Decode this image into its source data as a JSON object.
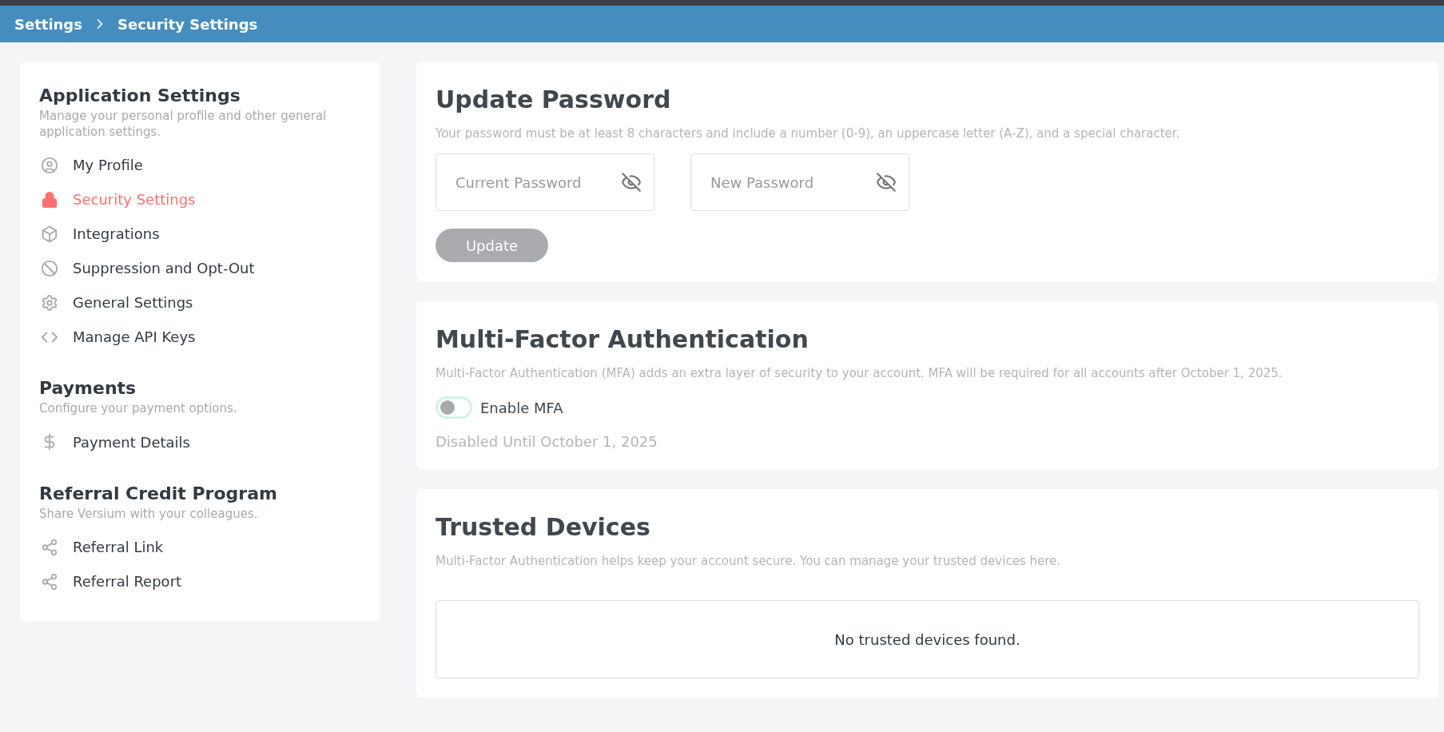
{
  "breadcrumb": [
    "Settings",
    "Security Settings"
  ],
  "sidebar": {
    "sections": [
      {
        "title": "Application Settings",
        "subtitle": "Manage your personal profile and other general application settings.",
        "items": [
          {
            "label": "My Profile",
            "kind": "profile",
            "selected": false
          },
          {
            "label": "Security Settings",
            "kind": "security",
            "selected": true
          },
          {
            "label": "Integrations",
            "kind": "integrations",
            "selected": false
          },
          {
            "label": "Suppression and Opt-Out",
            "kind": "suppression",
            "selected": false
          },
          {
            "label": "General Settings",
            "kind": "general",
            "selected": false
          },
          {
            "label": "Manage API Keys",
            "kind": "api",
            "selected": false
          }
        ]
      },
      {
        "title": "Payments",
        "subtitle": "Configure your payment options.",
        "items": [
          {
            "label": "Payment Details",
            "kind": "payment",
            "selected": false
          }
        ]
      },
      {
        "title": "Referral Credit Program",
        "subtitle": "Share Versium with your colleagues.",
        "items": [
          {
            "label": "Referral Link",
            "kind": "share",
            "selected": false
          },
          {
            "label": "Referral Report",
            "kind": "share",
            "selected": false
          }
        ]
      }
    ]
  },
  "update_password": {
    "title": "Update Password",
    "description": "Your password must be at least 8 characters and include a number (0-9), an uppercase letter (A-Z), and a special character.",
    "fields": [
      {
        "placeholder": "Current Password"
      },
      {
        "placeholder": "New Password"
      }
    ],
    "button": {
      "label": "Update",
      "disabled": true
    }
  },
  "mfa": {
    "title": "Multi-Factor Authentication",
    "description": "Multi-Factor Authentication (MFA) adds an extra layer of security to your account. MFA will be required for all accounts after October 1, 2025.",
    "toggle": {
      "label": "Enable MFA",
      "on": false
    },
    "note": "Disabled Until October 1, 2025"
  },
  "trusted_devices": {
    "title": "Trusted Devices",
    "description": "Multi-Factor Authentication helps keep your account secure. You can manage your trusted devices here.",
    "empty_message": "No trusted devices found."
  }
}
